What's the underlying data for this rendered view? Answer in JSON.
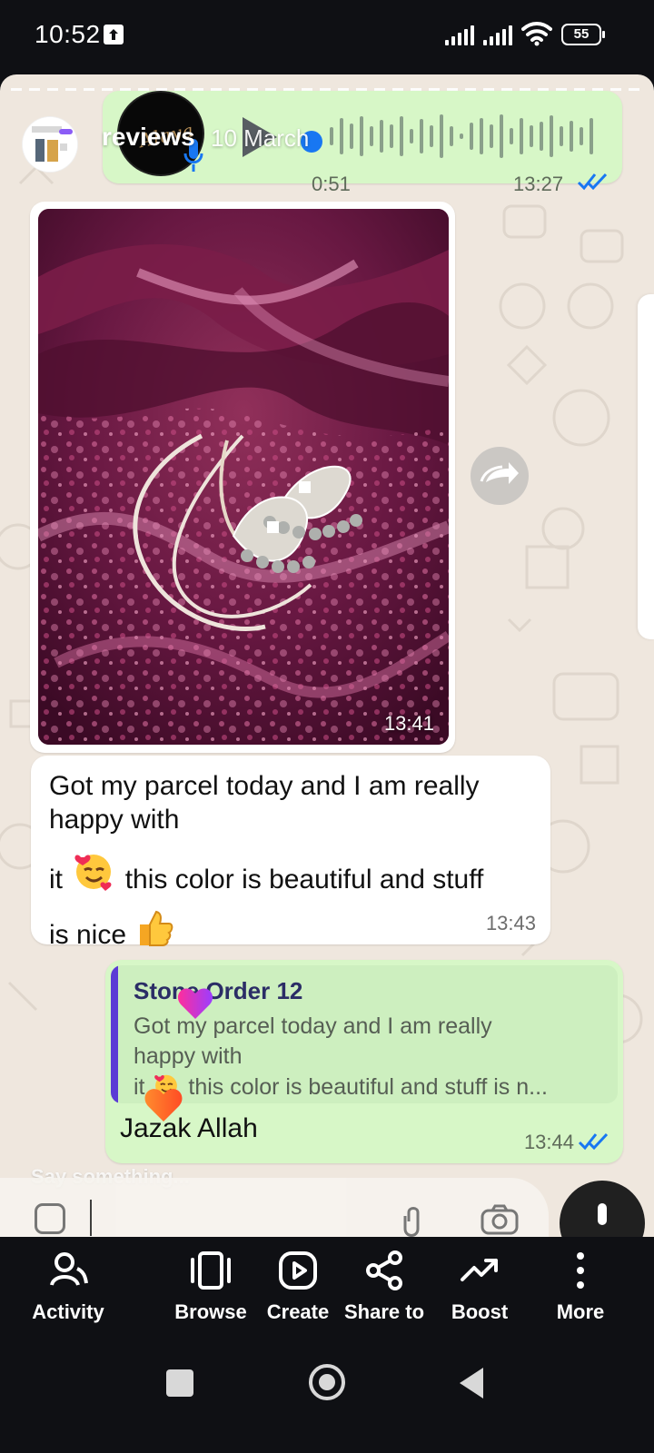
{
  "status_bar": {
    "time": "10:52",
    "battery": "55",
    "upload_icon": "upload-arrow-icon",
    "signal_icon": "signal-icon",
    "wifi_icon": "wifi-icon"
  },
  "post": {
    "title": "reviews",
    "date": "10 March",
    "say_something": "Say something..."
  },
  "chat": {
    "audio_message": {
      "duration": "0:51",
      "time": "13:27",
      "status_icon": "double-check-icon"
    },
    "image_message": {
      "time": "13:41"
    },
    "incoming_message": {
      "line_1": "Got my parcel today and I am really",
      "line_2": "happy with",
      "line_3_prefix": " it",
      "line_3_suffix": "this color is beautiful and stuff",
      "line_4": "is nice",
      "time": "13:43"
    },
    "reply_message": {
      "quoted_name": "Stone Order 12",
      "quoted_line_1": "Got my parcel today and I am really",
      "quoted_line_2": "happy with",
      "quoted_line_3_prefix": " it",
      "quoted_line_3_suffix": "this color is beautiful and stuff is n...",
      "text": "Jazak Allah",
      "time": "13:44"
    }
  },
  "toolbar": {
    "items": [
      {
        "label": "Activity",
        "icon": "activity-icon"
      },
      {
        "label": "Browse",
        "icon": "browse-icon"
      },
      {
        "label": "Create",
        "icon": "create-icon"
      },
      {
        "label": "Share to",
        "icon": "share-icon"
      },
      {
        "label": "Boost",
        "icon": "boost-icon"
      },
      {
        "label": "More",
        "icon": "more-icon"
      }
    ]
  },
  "navigation": {
    "recent_icon": "recent-apps-icon",
    "home_icon": "home-icon",
    "back_icon": "back-icon"
  },
  "colors": {
    "chat_background": "#efe7de",
    "incoming_bubble": "#ffffff",
    "outgoing_bubble": "#d7f7c7",
    "read_receipt": "#1877f2",
    "toolbar_background": "#0f1014"
  }
}
